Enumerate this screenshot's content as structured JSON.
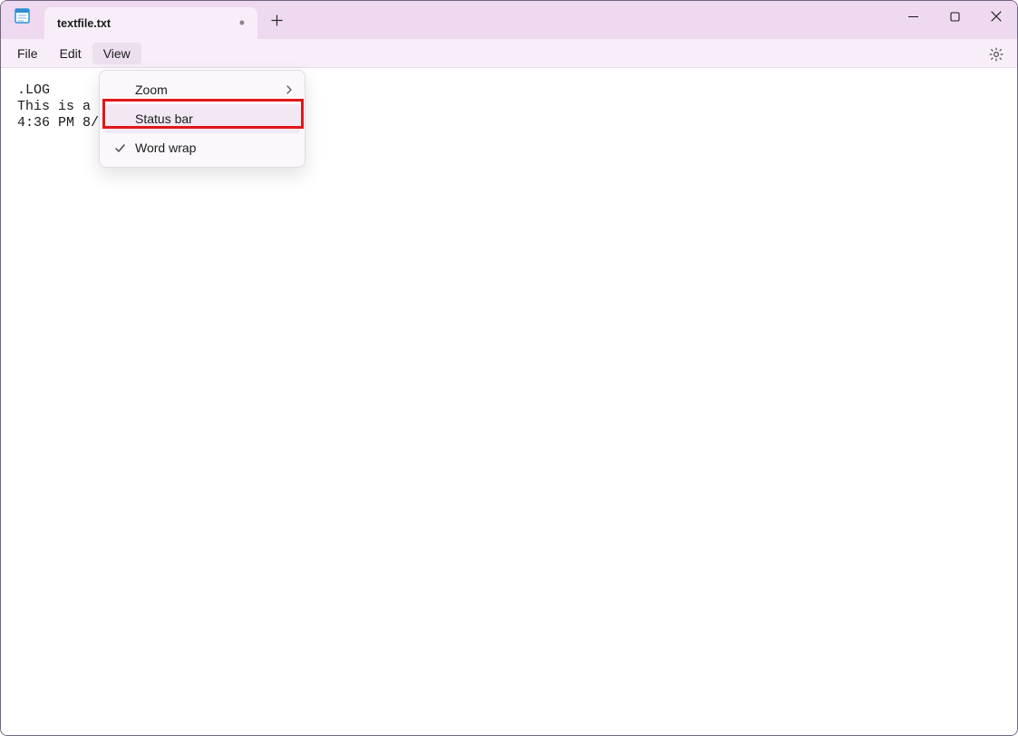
{
  "tab": {
    "title": "textfile.txt",
    "dirty_indicator": "•"
  },
  "menubar": {
    "file": "File",
    "edit": "Edit",
    "view": "View"
  },
  "view_menu": {
    "zoom": "Zoom",
    "status_bar": "Status bar",
    "word_wrap": "Word wrap"
  },
  "editor": {
    "line1": ".LOG",
    "line2": "This is a t",
    "line3": "4:36 PM 8/2"
  }
}
